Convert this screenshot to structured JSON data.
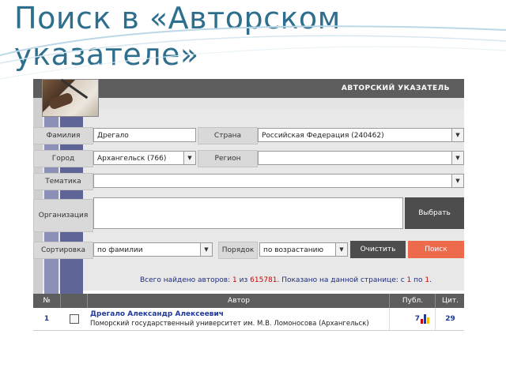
{
  "slide_title": "Поиск в «Авторском указателе»",
  "colors": {
    "title": "#2e6f8e",
    "header": "#5d5d5d",
    "search_button": "#ee6a4d",
    "link": "#1f3a9a",
    "highlight": "#d00000"
  },
  "panel": {
    "header": "АВТОРСКИЙ УКАЗАТЕЛЬ",
    "form": {
      "surname_label": "Фамилия",
      "surname_value": "Дрегало",
      "country_label": "Страна",
      "country_value": "Российская Федерация (240462)",
      "city_label": "Город",
      "city_value": "Архангельск (766)",
      "region_label": "Регион",
      "region_value": "",
      "topic_label": "Тематика",
      "topic_value": "",
      "org_label": "Организация",
      "org_value": "",
      "select_button": "Выбрать",
      "sort_label": "Сортировка",
      "sort_value": "по фамилии",
      "order_label": "Порядок",
      "order_value": "по возрастанию",
      "clear_button": "Очистить",
      "search_button": "Поиск"
    },
    "summary": {
      "prefix": "Всего найдено авторов:",
      "found": "1",
      "of_word": "из",
      "total": "615781",
      "shown_prefix": ". Показано на данной странице: с",
      "from": "1",
      "to_word": "по",
      "to": "1",
      "suffix": "."
    },
    "table": {
      "columns": {
        "num": "№",
        "author": "Автор",
        "pubs": "Публ.",
        "cites": "Цит."
      },
      "rows": [
        {
          "num": "1",
          "name": "Дрегало Александр Алексеевич",
          "org": "Поморский государственный университет им. М.В. Ломоносова (Архангельск)",
          "pubs": "7",
          "cites": "29"
        }
      ]
    }
  }
}
